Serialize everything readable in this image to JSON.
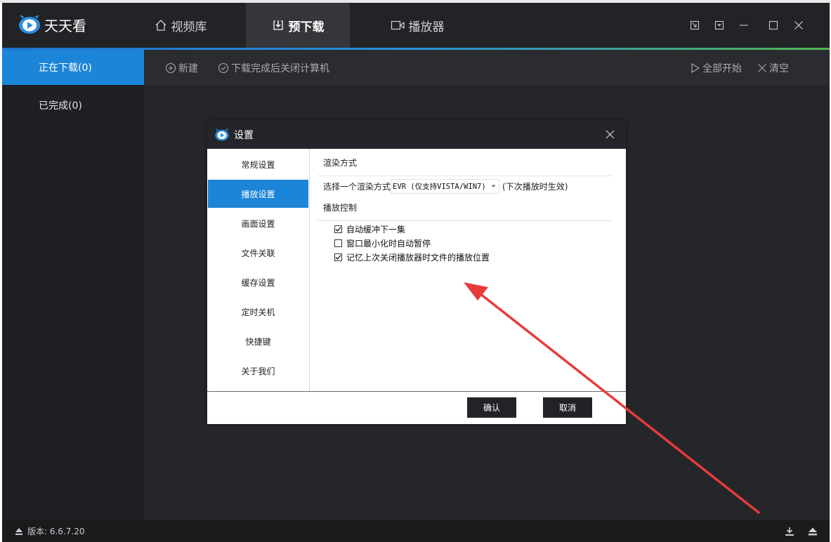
{
  "app": {
    "name": "天天看",
    "nav": [
      {
        "label": "视频库",
        "icon": "home-icon"
      },
      {
        "label": "预下载",
        "icon": "download-icon"
      },
      {
        "label": "播放器",
        "icon": "player-icon"
      }
    ],
    "active_nav": 1
  },
  "sidebar": {
    "items": [
      {
        "label": "正在下载(0)"
      },
      {
        "label": "已完成(0)"
      }
    ]
  },
  "toolbar": {
    "new_label": "新建",
    "shutdown_label": "下载完成后关闭计算机",
    "start_all_label": "全部开始",
    "clear_label": "清空"
  },
  "status": {
    "version": "版本: 6.6.7.20"
  },
  "dialog": {
    "title": "设置",
    "nav": [
      "常规设置",
      "播放设置",
      "画面设置",
      "文件关联",
      "缓存设置",
      "定时关机",
      "快捷键",
      "关于我们"
    ],
    "active_index": 1,
    "render_section": "渲染方式",
    "render_prefix": "选择一个渲染方式",
    "render_value": "EVR (仅支持VISTA/WIN7)",
    "render_suffix": "(下次播放时生效)",
    "playback_section": "播放控制",
    "options": [
      {
        "label": "自动缓冲下一集",
        "checked": true
      },
      {
        "label": "窗口最小化时自动暂停",
        "checked": false
      },
      {
        "label": "记忆上次关闭播放器时文件的播放位置",
        "checked": true
      }
    ],
    "confirm_label": "确认",
    "cancel_label": "取消"
  },
  "colors": {
    "accent_blue": "#1c85d8",
    "arrow_red": "#e63b3b"
  }
}
